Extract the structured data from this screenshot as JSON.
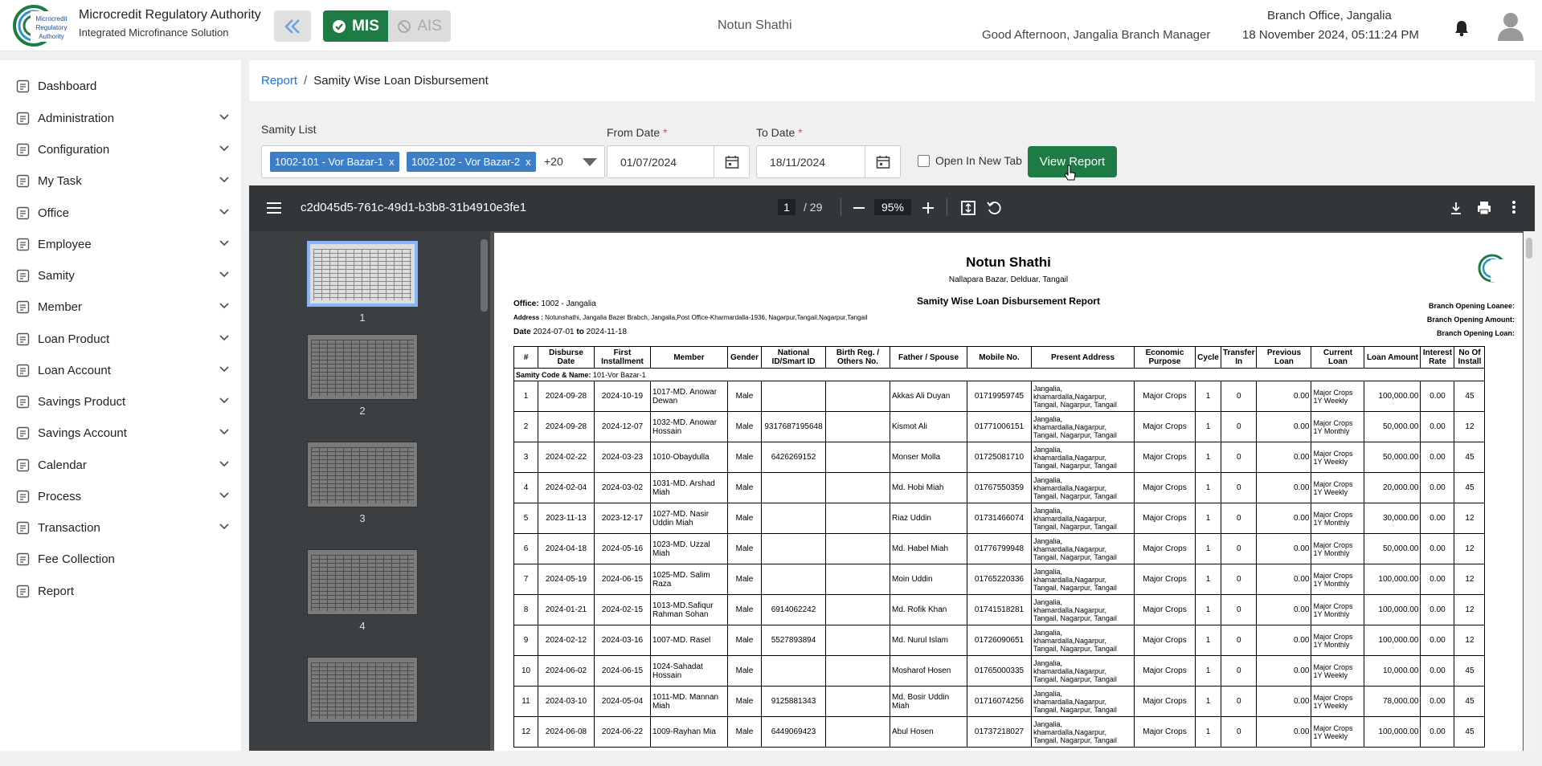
{
  "header": {
    "brand_title": "Microcredit Regulatory Authority",
    "brand_subtitle": "Integrated Microfinance Solution",
    "logo_text": "Microcredit Regulatory Authority",
    "mis_label": "MIS",
    "ais_label": "AIS",
    "org_name": "Notun Shathi",
    "greeting": "Good Afternoon, Jangalia Branch Manager",
    "office": "Branch Office, Jangalia",
    "datetime": "18 November 2024, 05:11:24 PM"
  },
  "sidebar": {
    "items": [
      {
        "label": "Dashboard",
        "icon": "dashboard-icon",
        "expandable": false
      },
      {
        "label": "Administration",
        "icon": "admin-icon",
        "expandable": true
      },
      {
        "label": "Configuration",
        "icon": "sliders-icon",
        "expandable": true
      },
      {
        "label": "My Task",
        "icon": "task-icon",
        "expandable": true
      },
      {
        "label": "Office",
        "icon": "office-icon",
        "expandable": true
      },
      {
        "label": "Employee",
        "icon": "employee-icon",
        "expandable": true
      },
      {
        "label": "Samity",
        "icon": "samity-icon",
        "expandable": true
      },
      {
        "label": "Member",
        "icon": "member-icon",
        "expandable": true
      },
      {
        "label": "Loan Product",
        "icon": "loan-product-icon",
        "expandable": true
      },
      {
        "label": "Loan Account",
        "icon": "loan-account-icon",
        "expandable": true
      },
      {
        "label": "Savings Product",
        "icon": "savings-product-icon",
        "expandable": true
      },
      {
        "label": "Savings Account",
        "icon": "savings-account-icon",
        "expandable": true
      },
      {
        "label": "Calendar",
        "icon": "calendar-icon",
        "expandable": true
      },
      {
        "label": "Process",
        "icon": "process-icon",
        "expandable": true
      },
      {
        "label": "Transaction",
        "icon": "transaction-icon",
        "expandable": true
      },
      {
        "label": "Fee Collection",
        "icon": "fee-icon",
        "expandable": false
      },
      {
        "label": "Report",
        "icon": "report-icon",
        "expandable": false
      }
    ]
  },
  "breadcrumb": {
    "parent": "Report",
    "separator": "/",
    "current": "Samity Wise Loan Disbursement"
  },
  "filters": {
    "samity_label": "Samity List",
    "chips": [
      "1002-101 - Vor Bazar-1",
      "1002-102 - Vor Bazar-2"
    ],
    "chip_remove": "x",
    "more_count": "+20",
    "from_label": "From Date",
    "from_value": "01/07/2024",
    "to_label": "To Date",
    "to_value": "18/11/2024",
    "required_mark": "*",
    "new_tab_label": "Open In New Tab",
    "view_button": "View Report"
  },
  "viewer": {
    "file_name": "c2d045d5-761c-49d1-b3b8-31b4910e3fe1",
    "page_current": "1",
    "page_total": "/ 29",
    "zoom": "95%",
    "thumb_numbers": [
      "1",
      "2",
      "3",
      "4"
    ]
  },
  "report": {
    "org": "Notun Shathi",
    "address_line": "Nallapara Bazar, Delduar, Tangail",
    "title": "Samity Wise Loan Disbursement Report",
    "office_label": "Office:",
    "office_value": "1002 - Jangalia",
    "address_label": "Address :",
    "address_value": "Notunshathi, Jangalia Bazer Brabch, Jangalia,Post Office-Kharmardalla-1936, Nagarpur,Tangail,Nagarpur,Tangail",
    "date_label": "Date",
    "date_from": "2024-07-01",
    "date_to_word": "to",
    "date_to": "2024-11-18",
    "right_labels": [
      "Branch Opening Loanee:",
      "Branch Opening Amount:",
      "Branch Opening Loan:"
    ],
    "columns": [
      "#",
      "Disburse Date",
      "First Installment",
      "Member",
      "Gender",
      "National ID/Smart ID",
      "Birth Reg. / Others No.",
      "Father / Spouse",
      "Mobile No.",
      "Present Address",
      "Economic Purpose",
      "Cycle",
      "Transfer In",
      "Previous Loan",
      "Current Loan",
      "Loan Amount",
      "Interest Rate",
      "No Of Install"
    ],
    "group_label": "Samity Code & Name:",
    "group_value": "101-Vor Bazar-1",
    "address_cell": "Jangalia, khamardalla,Nagarpur, Tangail, Nagarpur, Tangail",
    "rows": [
      [
        "1",
        "2024-09-28",
        "2024-10-19",
        "1017-MD. Anowar Dewan",
        "Male",
        "",
        "",
        "Akkas Ali Duyan",
        "01719959745",
        "Major Crops",
        "1",
        "0",
        "0.00",
        "Major Crops 1Y Weekly",
        "100,000.00",
        "0.00",
        "45"
      ],
      [
        "2",
        "2024-09-28",
        "2024-12-07",
        "1032-MD. Anowar Hossain",
        "Male",
        "9317687195648",
        "",
        "Kismot Ali",
        "01771006151",
        "Major Crops",
        "1",
        "0",
        "0.00",
        "Major Crops 1Y Monthly",
        "50,000.00",
        "0.00",
        "12"
      ],
      [
        "3",
        "2024-02-22",
        "2024-03-23",
        "1010-Obaydulla",
        "Male",
        "6426269152",
        "",
        "Monser Molla",
        "01725081710",
        "Major Crops",
        "1",
        "0",
        "0.00",
        "Major Crops 1Y Weekly",
        "50,000.00",
        "0.00",
        "45"
      ],
      [
        "4",
        "2024-02-04",
        "2024-03-02",
        "1031-MD. Arshad Miah",
        "Male",
        "",
        "",
        "Md. Hobi Miah",
        "01767550359",
        "Major Crops",
        "1",
        "0",
        "0.00",
        "Major Crops 1Y Weekly",
        "20,000.00",
        "0.00",
        "45"
      ],
      [
        "5",
        "2023-11-13",
        "2023-12-17",
        "1027-MD. Nasir Uddin Miah",
        "Male",
        "",
        "",
        "Riaz Uddin",
        "01731466074",
        "Major Crops",
        "1",
        "0",
        "0.00",
        "Major Crops 1Y Monthly",
        "30,000.00",
        "0.00",
        "12"
      ],
      [
        "6",
        "2024-04-18",
        "2024-05-16",
        "1023-MD. Uzzal Miah",
        "Male",
        "",
        "",
        "Md. Habel Miah",
        "01776799948",
        "Major Crops",
        "1",
        "0",
        "0.00",
        "Major Crops 1Y Monthly",
        "50,000.00",
        "0.00",
        "12"
      ],
      [
        "7",
        "2024-05-19",
        "2024-06-15",
        "1025-MD. Salim Raza",
        "Male",
        "",
        "",
        "Moin Uddin",
        "01765220336",
        "Major Crops",
        "1",
        "0",
        "0.00",
        "Major Crops 1Y Monthly",
        "100,000.00",
        "0.00",
        "12"
      ],
      [
        "8",
        "2024-01-21",
        "2024-02-15",
        "1013-MD.Safiqur Rahman Sohan",
        "Male",
        "6914062242",
        "",
        "Md. Rofik Khan",
        "01741518281",
        "Major Crops",
        "1",
        "0",
        "0.00",
        "Major Crops 1Y Monthly",
        "100,000.00",
        "0.00",
        "12"
      ],
      [
        "9",
        "2024-02-12",
        "2024-03-16",
        "1007-MD. Rasel",
        "Male",
        "5527893894",
        "",
        "Md. Nurul Islam",
        "01726090651",
        "Major Crops",
        "1",
        "0",
        "0.00",
        "Major Crops 1Y Monthly",
        "100,000.00",
        "0.00",
        "12"
      ],
      [
        "10",
        "2024-06-02",
        "2024-06-15",
        "1024-Sahadat Hossain",
        "Male",
        "",
        "",
        "Mosharof Hosen",
        "01765000335",
        "Major Crops",
        "1",
        "0",
        "0.00",
        "Major Crops 1Y Weekly",
        "10,000.00",
        "0.00",
        "45"
      ],
      [
        "11",
        "2024-03-10",
        "2024-05-04",
        "1011-MD. Mannan Miah",
        "Male",
        "9125881343",
        "",
        "Md. Bosir Uddin Miah",
        "01716074256",
        "Major Crops",
        "1",
        "0",
        "0.00",
        "Major Crops 1Y Weekly",
        "78,000.00",
        "0.00",
        "45"
      ],
      [
        "12",
        "2024-06-08",
        "2024-06-22",
        "1009-Rayhan Mia",
        "Male",
        "6449069423",
        "",
        "Abul Hosen",
        "01737218027",
        "Major Crops",
        "1",
        "0",
        "0.00",
        "Major Crops 1Y Weekly",
        "100,000.00",
        "0.00",
        "45"
      ]
    ]
  },
  "colors": {
    "green": "#1e7b45",
    "link": "#1a73e8",
    "chip": "#3d7ec6"
  }
}
